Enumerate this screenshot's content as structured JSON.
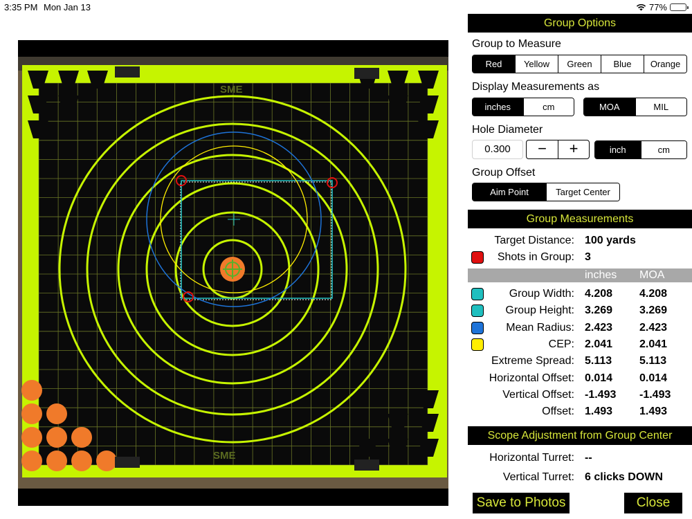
{
  "status_bar": {
    "time": "3:35 PM",
    "date": "Mon Jan 13",
    "battery": "77%",
    "battery_fraction": 0.77,
    "wifi_icon": "wifi-icon"
  },
  "target": {
    "brand_top": "SME",
    "brand_bottom": "SME",
    "accent": "#c6f400"
  },
  "group_options": {
    "title": "Group Options",
    "measure_label": "Group to Measure",
    "groups": [
      "Red",
      "Yellow",
      "Green",
      "Blue",
      "Orange"
    ],
    "display_label": "Display Measurements as",
    "units": [
      "inches",
      "cm"
    ],
    "angular": [
      "MOA",
      "MIL"
    ],
    "hole_label": "Hole Diameter",
    "hole_value": "0.300",
    "minus": "−",
    "plus": "+",
    "hole_units": [
      "inch",
      "cm"
    ],
    "offset_label": "Group Offset",
    "offset_opts": [
      "Aim Point",
      "Target Center"
    ]
  },
  "measurements": {
    "title": "Group Measurements",
    "target_distance_label": "Target Distance:",
    "target_distance": "100 yards",
    "shots_label": "Shots in Group:",
    "shots": "3",
    "col_inches": "inches",
    "col_moa": "MOA",
    "rows": [
      {
        "label": "Group Width:",
        "inches": "4.208",
        "moa": "4.208",
        "color": "#1fbfbf"
      },
      {
        "label": "Group Height:",
        "inches": "3.269",
        "moa": "3.269",
        "color": "#1fbfbf"
      },
      {
        "label": "Mean Radius:",
        "inches": "2.423",
        "moa": "2.423",
        "color": "#1e73d8"
      },
      {
        "label": "CEP:",
        "inches": "2.041",
        "moa": "2.041",
        "color": "#ffee00"
      },
      {
        "label": "Extreme Spread:",
        "inches": "5.113",
        "moa": "5.113"
      },
      {
        "label": "Horizontal Offset:",
        "inches": "0.014",
        "moa": "0.014"
      },
      {
        "label": "Vertical Offset:",
        "inches": "-1.493",
        "moa": "-1.493"
      },
      {
        "label": "Offset:",
        "inches": "1.493",
        "moa": "1.493"
      }
    ]
  },
  "scope": {
    "title": "Scope Adjustment from Group Center",
    "horizontal_label": "Horizontal Turret:",
    "horizontal_value": "--",
    "vertical_label": "Vertical Turret:",
    "vertical_value": "6 clicks DOWN"
  },
  "actions": {
    "save": "Save to Photos",
    "close": "Close"
  },
  "colors": {
    "panel_bar": "#000000",
    "accent_text": "#d7e63a",
    "shot_red": "#e01010"
  }
}
